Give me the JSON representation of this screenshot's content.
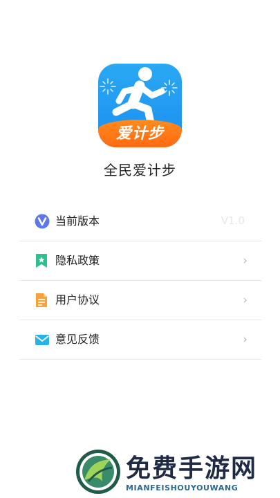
{
  "app": {
    "logo_text": "爱计步",
    "name": "全民爱计步"
  },
  "menu": {
    "items": [
      {
        "label": "当前版本",
        "icon": "version-v-icon",
        "value": "V1.0"
      },
      {
        "label": "隐私政策",
        "icon": "privacy-bookmark-icon"
      },
      {
        "label": "用户协议",
        "icon": "agreement-document-icon"
      },
      {
        "label": "意见反馈",
        "icon": "feedback-mail-icon"
      }
    ]
  },
  "watermark": {
    "title": "免费手游网",
    "subtitle": "MIANFEISHOUYOUWANG"
  },
  "colors": {
    "logo_blue": "#1b8ff0",
    "logo_orange": "#ff6a12",
    "divider": "#e8e8e8",
    "chevron": "#b9b9b9"
  }
}
